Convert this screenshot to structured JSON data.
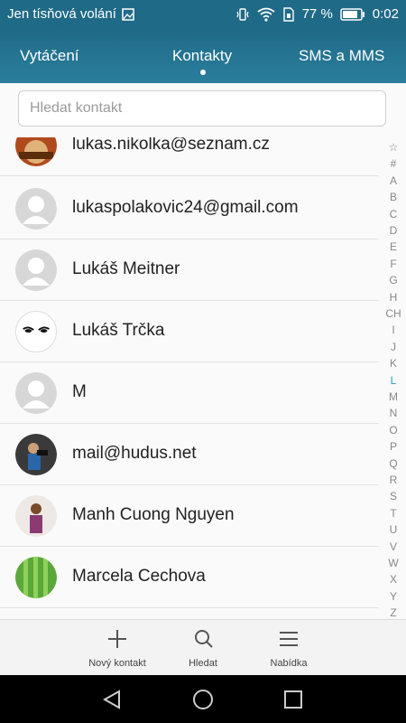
{
  "status": {
    "carrier": "Jen tísňová volání",
    "battery_pct": "77 %",
    "time": "0:02"
  },
  "tabs": [
    {
      "label": "Vytáčení"
    },
    {
      "label": "Kontakty"
    },
    {
      "label": "SMS a MMS"
    }
  ],
  "search": {
    "placeholder": "Hledat kontakt"
  },
  "contacts": [
    {
      "name": "lukas.nikolka@seznam.cz",
      "avatar": "photo"
    },
    {
      "name": "lukaspolakovic24@gmail.com",
      "avatar": "placeholder"
    },
    {
      "name": "Lukáš Meitner",
      "avatar": "placeholder"
    },
    {
      "name": "Lukáš Trčka",
      "avatar": "eyes"
    },
    {
      "name": "M",
      "avatar": "placeholder"
    },
    {
      "name": "mail@hudus.net",
      "avatar": "photo"
    },
    {
      "name": "Manh Cuong Nguyen",
      "avatar": "photo"
    },
    {
      "name": "Marcela Cechova",
      "avatar": "photo"
    }
  ],
  "index_letters": [
    "☆",
    "#",
    "A",
    "B",
    "C",
    "D",
    "E",
    "F",
    "G",
    "H",
    "CH",
    "I",
    "J",
    "K",
    "L",
    "M",
    "N",
    "O",
    "P",
    "Q",
    "R",
    "S",
    "T",
    "U",
    "V",
    "W",
    "X",
    "Y",
    "Z"
  ],
  "index_active": "L",
  "colors": {
    "accent": "#1f6a87",
    "index_active": "#2a9bd0"
  },
  "actions": [
    {
      "label": "Nový kontakt",
      "icon": "plus-icon"
    },
    {
      "label": "Hledat",
      "icon": "search-icon"
    },
    {
      "label": "Nabídka",
      "icon": "menu-icon"
    }
  ],
  "nav": [
    "back-icon",
    "home-icon",
    "recents-icon"
  ]
}
